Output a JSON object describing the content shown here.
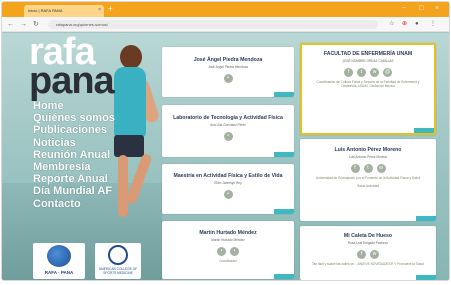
{
  "browser": {
    "tab_title": "Inicio | RAFA PANA",
    "tab_close": "×",
    "new_tab": "+",
    "window_controls": {
      "minimize": "−",
      "maximize": "□",
      "close": "×"
    },
    "nav": {
      "back": "←",
      "forward": "→",
      "reload": "↻"
    },
    "url": "rafapana.org/quienes-somos/",
    "toolbar_icons": [
      "star-icon",
      "extension-icon",
      "profile-icon",
      "menu-icon"
    ],
    "toolbar_glyphs": {
      "star": "☆",
      "extension": "⊕",
      "profile": "●",
      "menu": "⋮"
    }
  },
  "brand": {
    "line1": "rafa",
    "line2": "pana"
  },
  "menu": {
    "items": [
      {
        "label": "Home"
      },
      {
        "label": "Quiénes somos"
      },
      {
        "label": "Publicaciones"
      },
      {
        "label": "Noticias"
      },
      {
        "label": "Reunión Anual"
      },
      {
        "label": "Membresía"
      },
      {
        "label": "Reporte Anual"
      },
      {
        "label": "Día Mundial AF"
      },
      {
        "label": "Contacto"
      }
    ]
  },
  "badges": {
    "rafa_caption": "RAFA · PANA",
    "acsm_caption": "AMERICAN COLLEGE OF SPORTS MEDICINE"
  },
  "cards": {
    "c1": {
      "title": "José Ángel Piedra Mendoza",
      "sub": "José Ángel Piedra Mendoza"
    },
    "c2": {
      "title": "FACULTAD DE ENFERMERÍA UNAM",
      "sub": "JOSÉ NOMBRE ORDAZ CASILLAS",
      "body": "Coordinación de Cultura Física y Deporte de la Facultad de Enfermería y Obstetricia, UNAM, Ciudad de México"
    },
    "c3": {
      "title": "Laboratorio de Tecnología y Actividad Física",
      "sub": "Ana Lilia González Pérez"
    },
    "c4": {
      "title": "Luis Antonio Pérez Moreno",
      "sub": "Luis Antonio Pérez Moreno",
      "body": "Universidad de Guanajuato, por el Fomento de la Actividad Física y Salud",
      "extra": "Salud Actividad"
    },
    "c5": {
      "title": "Maestría en Actividad Física y Estilo de Vida",
      "sub": "Ellen Jamesyn Rey"
    },
    "c6": {
      "title": "Martín Hurtado Méndez",
      "sub": "Martín Hurtado Méndez",
      "body": "Coordinador"
    },
    "c7": {
      "title": "Mi Caleta De Hueso",
      "sub": "Rosa Leal Delgado Pacheco",
      "body": "Tan fácil y suave las calles se... ¡MUEVE NOVEDADES!!! Y Promueve la Salud"
    }
  }
}
